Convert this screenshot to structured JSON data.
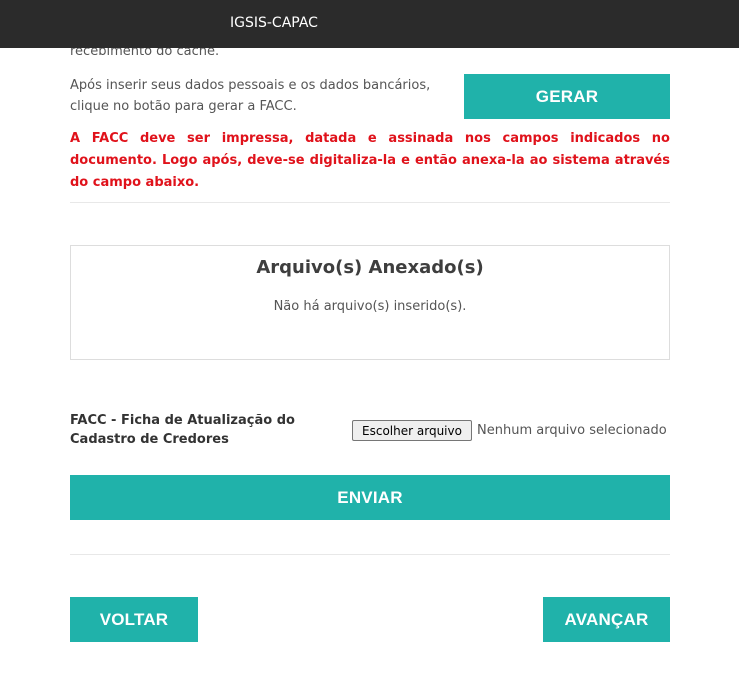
{
  "navbar": {
    "brand": "IGSIS-CAPAC"
  },
  "intro": {
    "cut_text": "recebimento do cachê."
  },
  "generate": {
    "instruction_line1": "Após inserir seus dados pessoais e os dados bancários,",
    "instruction_line2": "clique no botão para gerar a FACC.",
    "button_label": "GERAR"
  },
  "warning": {
    "text": "A FACC deve ser impressa, datada e assinada nos campos indicados no documento. Logo após, deve-se digitaliza-la e então anexa-la ao sistema através do campo abaixo."
  },
  "attachments": {
    "title": "Arquivo(s) Anexado(s)",
    "empty_message": "Não há arquivo(s) inserido(s)."
  },
  "upload": {
    "label": "FACC - Ficha de Atualização do Cadastro de Credores",
    "choose_button": "Escolher arquivo",
    "status": "Nenhum arquivo selecionado",
    "submit_label": "ENVIAR"
  },
  "navigation": {
    "back_label": "VOLTAR",
    "next_label": "AVANÇAR"
  },
  "colors": {
    "accent": "#20b2aa",
    "warning": "#e0121b",
    "navbar": "#2b2b2b"
  }
}
